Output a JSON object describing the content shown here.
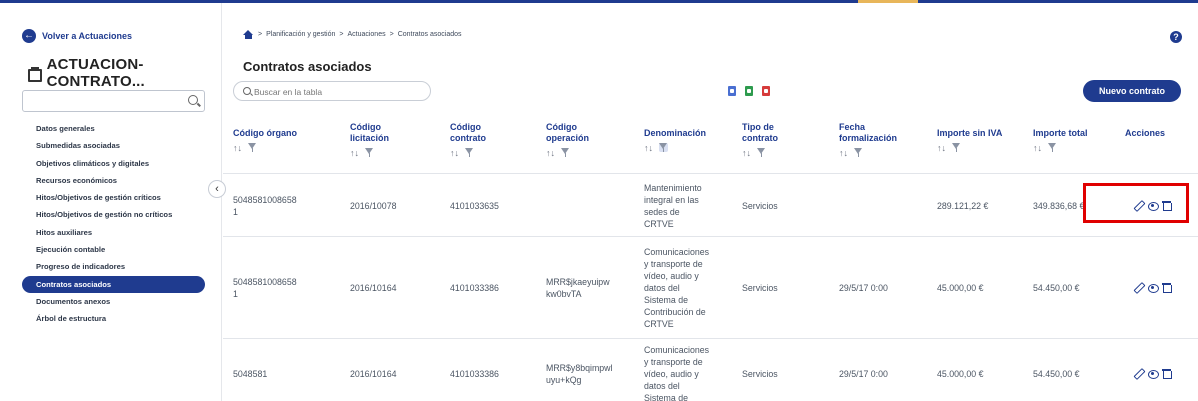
{
  "sidebar": {
    "back_label": "Volver a Actuaciones",
    "title": "ACTUACION-CONTRATO...",
    "search_placeholder": "",
    "items": [
      {
        "label": "Datos generales",
        "active": false
      },
      {
        "label": "Submedidas asociadas",
        "active": false
      },
      {
        "label": "Objetivos climáticos y digitales",
        "active": false
      },
      {
        "label": "Recursos económicos",
        "active": false
      },
      {
        "label": "Hitos/Objetivos de gestión críticos",
        "active": false
      },
      {
        "label": "Hitos/Objetivos de gestión no críticos",
        "active": false
      },
      {
        "label": "Hitos auxiliares",
        "active": false
      },
      {
        "label": "Ejecución contable",
        "active": false
      },
      {
        "label": "Progreso de indicadores",
        "active": false
      },
      {
        "label": "Contratos asociados",
        "active": true
      },
      {
        "label": "Documentos anexos",
        "active": false
      },
      {
        "label": "Árbol de estructura",
        "active": false
      }
    ],
    "collapse_glyph": "‹"
  },
  "header": {
    "breadcrumb": [
      "Planificación y gestión",
      "Actuaciones",
      "Contratos asociados"
    ],
    "separator": ">",
    "help_glyph": "?"
  },
  "main": {
    "title": "Contratos asociados",
    "search_placeholder": "Buscar en la tabla",
    "new_button": "Nuevo contrato",
    "export_icons": [
      {
        "name": "copy-icon",
        "color": "#4a6fd1"
      },
      {
        "name": "excel-icon",
        "color": "#2e9b4e"
      },
      {
        "name": "pdf-icon",
        "color": "#d63b3b"
      }
    ]
  },
  "table": {
    "sort_glyph": "↑↓",
    "columns": [
      {
        "label_lines": [
          "Código órgano"
        ]
      },
      {
        "label_lines": [
          "Código",
          "licitación"
        ]
      },
      {
        "label_lines": [
          "Código",
          "contrato"
        ]
      },
      {
        "label_lines": [
          "Código",
          "operación"
        ]
      },
      {
        "label_lines": [
          "Denominación"
        ]
      },
      {
        "label_lines": [
          "Tipo de",
          "contrato"
        ]
      },
      {
        "label_lines": [
          "Fecha",
          "formalización"
        ]
      },
      {
        "label_lines": [
          "Importe sin IVA"
        ]
      },
      {
        "label_lines": [
          "Importe total"
        ]
      },
      {
        "label_lines": [
          "Acciones"
        ]
      }
    ],
    "rows": [
      {
        "codigo_organo": [
          "5048581008658",
          "1"
        ],
        "codigo_licitacion": "2016/10078",
        "codigo_contrato": "4101033635",
        "codigo_operacion": [],
        "denominacion": [
          "Mantenimiento",
          "integral en las",
          "sedes de",
          "CRTVE"
        ],
        "tipo": "Servicios",
        "fecha": "",
        "importe_sin_iva": "289.121,22 €",
        "importe_total": "349.836,68 €"
      },
      {
        "codigo_organo": [
          "5048581008658",
          "1"
        ],
        "codigo_licitacion": "2016/10164",
        "codigo_contrato": "4101033386",
        "codigo_operacion": [
          "MRR$jkaeyuipw",
          "kw0bvTA"
        ],
        "denominacion": [
          "Comunicaciones",
          "y transporte de",
          "vídeo, audio y",
          "datos del",
          "Sistema de",
          "Contribución de",
          "CRTVE"
        ],
        "tipo": "Servicios",
        "fecha": "29/5/17 0:00",
        "importe_sin_iva": "45.000,00 €",
        "importe_total": "54.450,00 €"
      },
      {
        "codigo_organo": [
          "5048581"
        ],
        "codigo_licitacion": "2016/10164",
        "codigo_contrato": "4101033386",
        "codigo_operacion": [
          "MRR$y8bqimpwl",
          "uyu+kQg"
        ],
        "denominacion": [
          "Comunicaciones",
          "y transporte de",
          "vídeo, audio y",
          "datos del",
          "Sistema de"
        ],
        "tipo": "Servicios",
        "fecha": "29/5/17 0:00",
        "importe_sin_iva": "45.000,00 €",
        "importe_total": "54.450,00 €"
      }
    ]
  },
  "colors": {
    "primary": "#1f3b8f",
    "highlight": "#e00000"
  }
}
